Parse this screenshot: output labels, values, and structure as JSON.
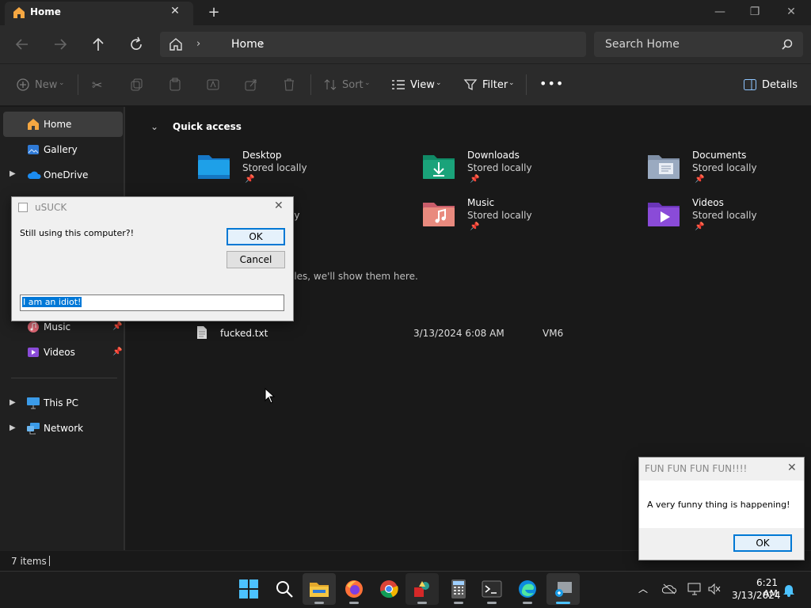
{
  "tab": {
    "title": "Home"
  },
  "address": {
    "crumb": "Home",
    "search_placeholder": "Search Home"
  },
  "toolbar": {
    "new": "New",
    "sort": "Sort",
    "view": "View",
    "filter": "Filter",
    "details": "Details"
  },
  "sidebar": {
    "home": "Home",
    "gallery": "Gallery",
    "onedrive": "OneDrive",
    "music": "Music",
    "videos": "Videos",
    "this_pc": "This PC",
    "network": "Network"
  },
  "main": {
    "quick_access": "Quick access",
    "folders": [
      {
        "name": "Desktop",
        "sub": "Stored locally"
      },
      {
        "name": "Downloads",
        "sub": "Stored locally"
      },
      {
        "name": "Documents",
        "sub": "Stored locally"
      },
      {
        "name": "Music",
        "sub": "Stored locally"
      },
      {
        "name": "Videos",
        "sub": "Stored locally"
      }
    ],
    "partial_sub": "ly",
    "recent_empty_partial": "iles, we'll show them here.",
    "file": {
      "name": "fucked.txt",
      "date": "3/13/2024 6:08 AM",
      "location": "VM6"
    }
  },
  "status": {
    "items": "7 items"
  },
  "clock": {
    "time": "6:21 AM",
    "date": "3/13/2024"
  },
  "dialog_usuck": {
    "title": "uSUCK",
    "message": "Still using this computer?!",
    "ok": "OK",
    "cancel": "Cancel",
    "input_value": "I am an idiot!"
  },
  "dialog_fun": {
    "title": "FUN FUN FUN FUN!!!!",
    "message": "A very funny thing is happening!",
    "ok": "OK"
  },
  "colors": {
    "accent": "#0078d4",
    "folder_desktop": "#1ea0e8",
    "folder_downloads": "#1aa37a",
    "folder_music": "#e66f5c",
    "folder_videos": "#8a4bd8"
  }
}
